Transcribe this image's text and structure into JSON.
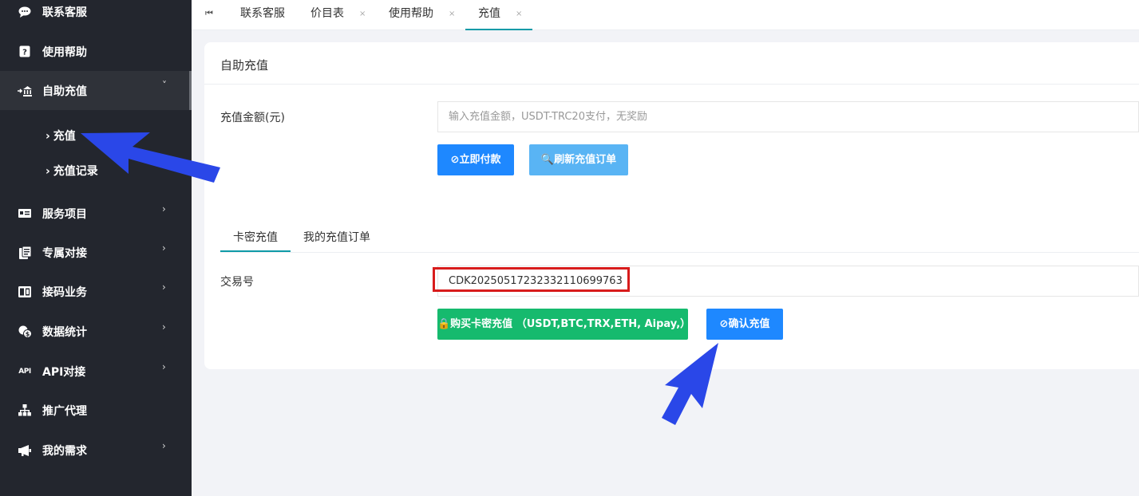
{
  "sidebar": {
    "items": [
      {
        "label": "联系客服",
        "icon": "chat-icon",
        "glyph": "💬",
        "has_chevron": false
      },
      {
        "label": "使用帮助",
        "icon": "help-icon",
        "glyph": "?",
        "has_chevron": false
      },
      {
        "label": "自助充值",
        "icon": "bank-icon",
        "glyph": "⇥",
        "has_chevron": true,
        "chevron": "˅",
        "open": true
      },
      {
        "label": "服务项目",
        "icon": "card-icon",
        "glyph": "▬",
        "has_chevron": true,
        "chevron": "›"
      },
      {
        "label": "专属对接",
        "icon": "document-icon",
        "glyph": "▤",
        "has_chevron": true,
        "chevron": "›"
      },
      {
        "label": "接码业务",
        "icon": "sim-icon",
        "glyph": "▥",
        "has_chevron": true,
        "chevron": "›"
      },
      {
        "label": "数据统计",
        "icon": "coins-icon",
        "glyph": "◉",
        "has_chevron": true,
        "chevron": "›"
      },
      {
        "label": "API对接",
        "icon": "api-icon",
        "glyph": "API",
        "has_chevron": true,
        "chevron": "›"
      },
      {
        "label": "推广代理",
        "icon": "sitemap-icon",
        "glyph": "⊞",
        "has_chevron": false
      },
      {
        "label": "我的需求",
        "icon": "megaphone-icon",
        "glyph": "◀",
        "has_chevron": true,
        "chevron": "›"
      }
    ],
    "sub_items": [
      {
        "label": "充值",
        "arrow": "›"
      },
      {
        "label": "充值记录",
        "arrow": "›"
      }
    ]
  },
  "topbar": {
    "first_icon": "⏮",
    "tabs": [
      {
        "label": "联系客服",
        "closable": false
      },
      {
        "label": "价目表",
        "closable": true
      },
      {
        "label": "使用帮助",
        "closable": true
      },
      {
        "label": "充值",
        "closable": true,
        "active": true
      }
    ],
    "close_glyph": "×"
  },
  "card": {
    "title": "自助充值",
    "amount_label": "充值金额(元)",
    "amount_placeholder": "输入充值金额，USDT-TRC20支付，无奖励",
    "pay_button": "⊘立即付款",
    "refresh_button": "🔍刷新充值订单",
    "tabs": [
      "卡密充值",
      "我的充值订单"
    ],
    "txn_label": "交易号",
    "txn_value": "CDK20250517232332110699763",
    "buy_button": "🔒购买卡密充值 （USDT,BTC,TRX,ETH, Aipay,）",
    "confirm_button": "⊘确认充值"
  },
  "colors": {
    "sidebar_bg": "#23262e",
    "accent_teal": "#0e9aa7",
    "button_blue": "#1e88ff",
    "button_light_blue": "#59b4f4",
    "button_green": "#16ba6e",
    "highlight_red": "#d81c1c",
    "annotation_arrow": "#2a47e8"
  }
}
